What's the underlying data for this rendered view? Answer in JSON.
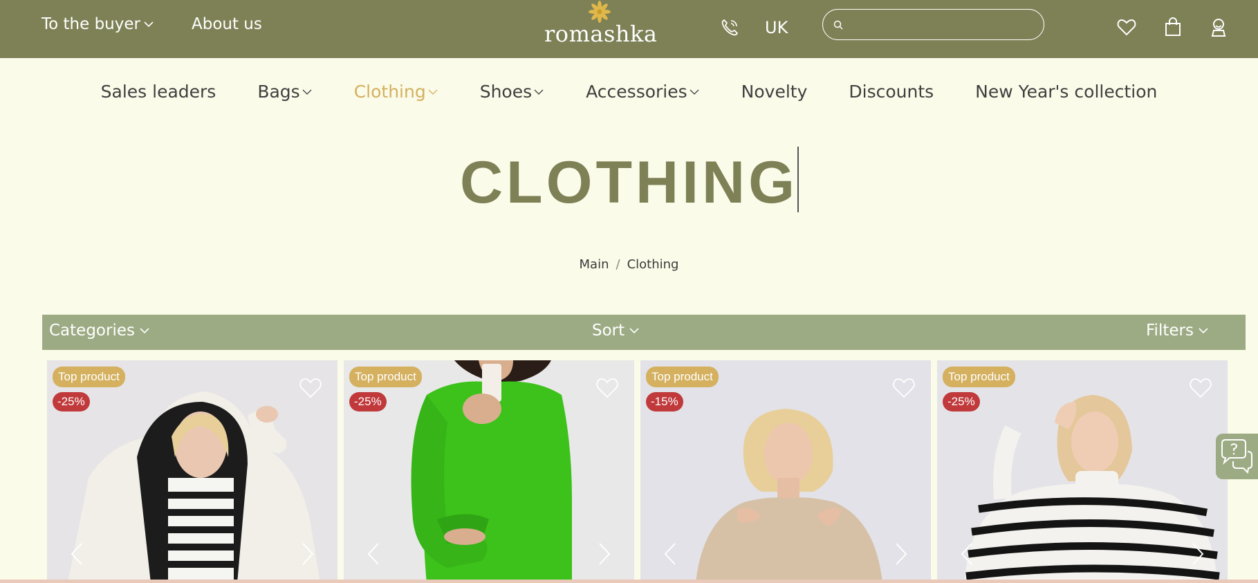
{
  "header": {
    "nav_left": [
      {
        "label": "To the buyer"
      },
      {
        "label": "About us"
      }
    ],
    "logo_text": "romashka",
    "language": "UK",
    "search": {
      "value": "",
      "placeholder": ""
    }
  },
  "menu": [
    {
      "label": "Sales leaders"
    },
    {
      "label": "Bags"
    },
    {
      "label": "Clothing"
    },
    {
      "label": "Shoes"
    },
    {
      "label": "Accessories"
    },
    {
      "label": "Novelty"
    },
    {
      "label": "Discounts"
    },
    {
      "label": "New Year's collection"
    }
  ],
  "page": {
    "title": "CLOTHING",
    "breadcrumb": [
      "Main",
      "Clothing"
    ]
  },
  "filterbar": {
    "categories": "Categories",
    "sort": "Sort",
    "filters": "Filters"
  },
  "products": [
    {
      "badge": "Top product",
      "discount": "-25%"
    },
    {
      "badge": "Top product",
      "discount": "-25%"
    },
    {
      "badge": "Top product",
      "discount": "-15%"
    },
    {
      "badge": "Top product",
      "discount": "-25%"
    }
  ],
  "colors": {
    "header_bg": "#7e8156",
    "accent": "#d4b05f",
    "filter_bg": "#9cab84",
    "discount": "#c0393b",
    "page_bg": "#fbfbe9"
  }
}
